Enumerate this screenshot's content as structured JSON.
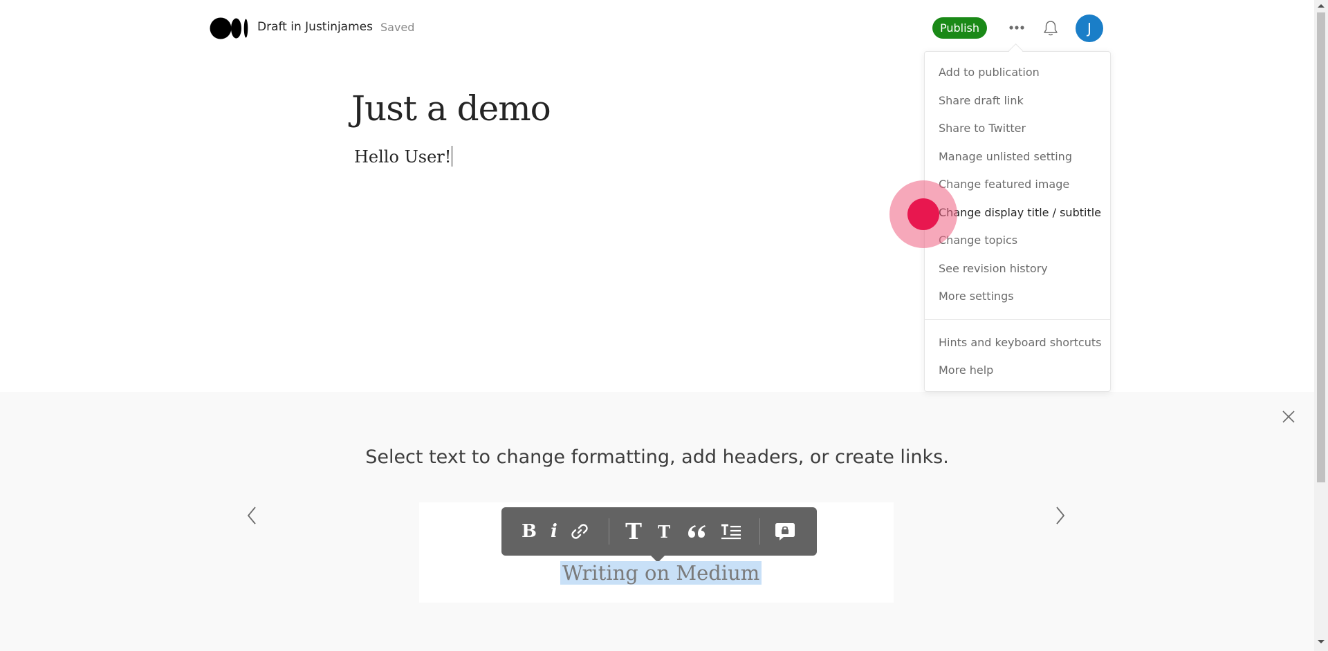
{
  "header": {
    "draft_label": "Draft in Justinjames",
    "status": "Saved",
    "publish_label": "Publish",
    "more_icon": "more-horizontal-icon",
    "notifications_icon": "bell-icon",
    "avatar_initial": "J"
  },
  "editor": {
    "title": "Just a demo",
    "body": "Hello User!"
  },
  "menu": {
    "items": [
      "Add to publication",
      "Share draft link",
      "Share to Twitter",
      "Manage unlisted setting",
      "Change featured image",
      "Change display title / subtitle",
      "Change topics",
      "See revision history",
      "More settings"
    ],
    "help_items": [
      "Hints and keyboard shortcuts",
      "More help"
    ]
  },
  "hints": {
    "text": "Select text to change formatting, add headers, or create links.",
    "demo_selected_text": "Writing on Medium",
    "toolbar": {
      "bold": "B",
      "italic": "i",
      "large_title": "T",
      "small_title": "T"
    }
  },
  "colors": {
    "publish": "#1a8917",
    "avatar": "#1a7ec8",
    "toolbar": "#636363",
    "selection": "#c8e0f7",
    "click_indicator": "#e8174f"
  }
}
